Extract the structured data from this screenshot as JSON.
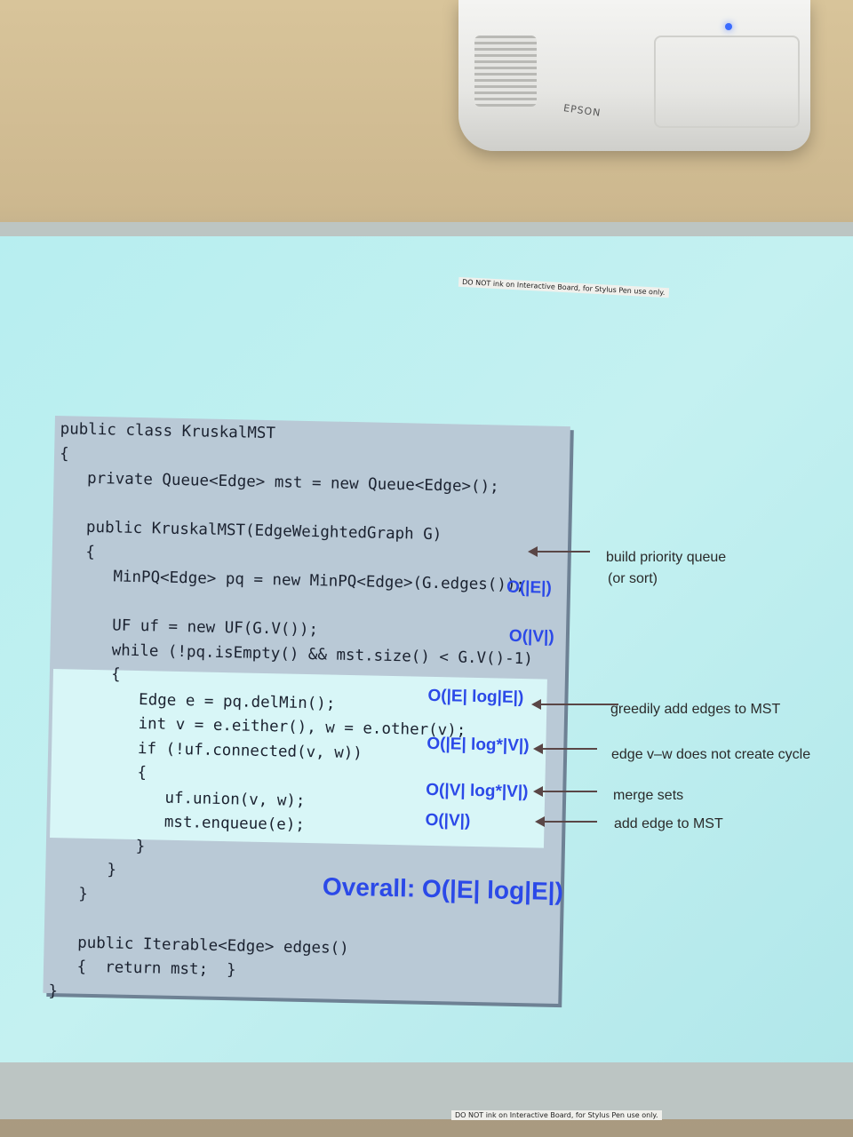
{
  "projector": {
    "brand": "EPSON"
  },
  "labels": {
    "board_notice": "DO NOT ink on Interactive Board, for Stylus Pen use only."
  },
  "slide": {
    "code_lines": [
      "public class KruskalMST",
      "{",
      "   private Queue<Edge> mst = new Queue<Edge>();",
      "",
      "   public KruskalMST(EdgeWeightedGraph G)",
      "   {",
      "      MinPQ<Edge> pq = new MinPQ<Edge>(G.edges());",
      "",
      "      UF uf = new UF(G.V());",
      "      while (!pq.isEmpty() && mst.size() < G.V()-1)",
      "      {",
      "         Edge e = pq.delMin();",
      "         int v = e.either(), w = e.other(v);",
      "         if (!uf.connected(v, w))",
      "         {",
      "            uf.union(v, w);",
      "            mst.enqueue(e);",
      "         }",
      "      }",
      "   }",
      "",
      "   public Iterable<Edge> edges()",
      "   {  return mst;  }",
      "}"
    ],
    "complexities": {
      "pq": "O(|E|)",
      "uf": "O(|V|)",
      "delmin": "O(|E| log|E|)",
      "connected": "O(|E| log*|V|)",
      "union": "O(|V| log*|V|)",
      "enqueue": "O(|V|)",
      "overall": "Overall: O(|E| log|E|)"
    },
    "annotations": {
      "pq_line1": "build priority queue",
      "pq_line2": "(or sort)",
      "greedy": "greedily add edges to MST",
      "cycle": "edge v–w does not create cycle",
      "merge": "merge sets",
      "add": "add edge to MST"
    }
  }
}
